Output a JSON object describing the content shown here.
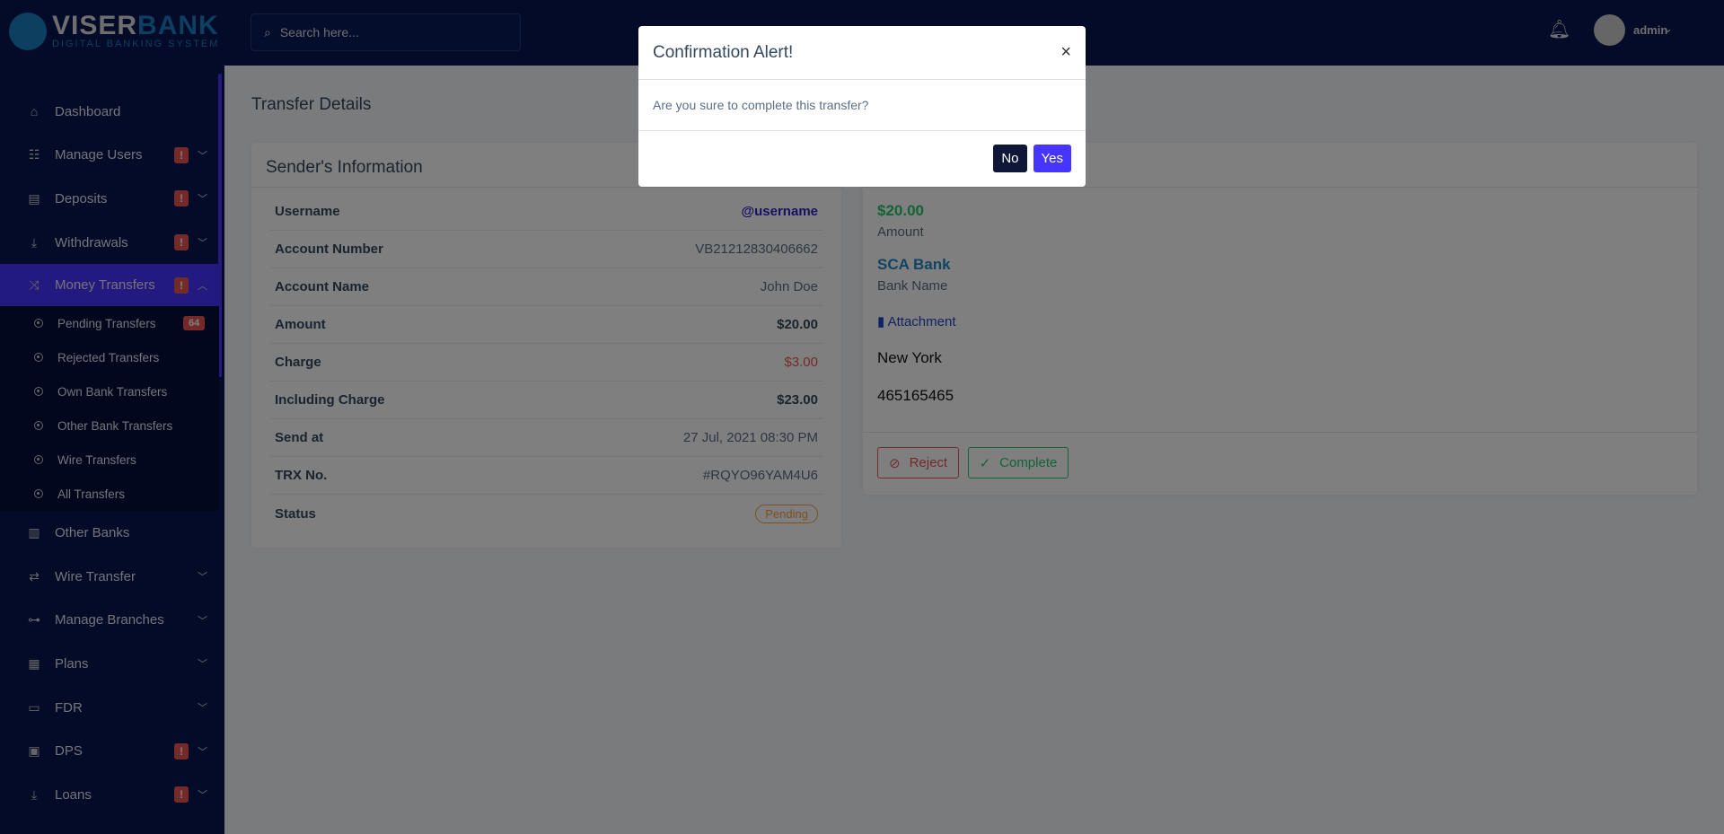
{
  "brand": {
    "name_a": "VISER",
    "name_b": "BANK",
    "tagline": "DIGITAL BANKING SYSTEM"
  },
  "sidebar": {
    "items": [
      {
        "label": "Dashboard",
        "icon": "home-icon",
        "alert": false,
        "chevron": false
      },
      {
        "label": "Manage Users",
        "icon": "users-icon",
        "alert": true,
        "chevron": true
      },
      {
        "label": "Deposits",
        "icon": "deposit-icon",
        "alert": true,
        "chevron": true
      },
      {
        "label": "Withdrawals",
        "icon": "withdraw-icon",
        "alert": true,
        "chevron": true
      },
      {
        "label": "Money Transfers",
        "icon": "shuffle-icon",
        "alert": true,
        "chevron": true,
        "active": true
      }
    ],
    "sub_items": [
      {
        "label": "Pending Transfers",
        "count": "64"
      },
      {
        "label": "Rejected Transfers"
      },
      {
        "label": "Own Bank Transfers"
      },
      {
        "label": "Other Bank Transfers"
      },
      {
        "label": "Wire Transfers"
      },
      {
        "label": "All Transfers"
      }
    ],
    "items_after": [
      {
        "label": "Other Banks",
        "icon": "bank-icon",
        "alert": false,
        "chevron": false
      },
      {
        "label": "Wire Transfer",
        "icon": "wire-icon",
        "alert": false,
        "chevron": true
      },
      {
        "label": "Manage Branches",
        "icon": "branches-icon",
        "alert": false,
        "chevron": true
      },
      {
        "label": "Plans",
        "icon": "chart-icon",
        "alert": false,
        "chevron": true
      },
      {
        "label": "FDR",
        "icon": "money-icon",
        "alert": false,
        "chevron": true
      },
      {
        "label": "DPS",
        "icon": "box-icon",
        "alert": true,
        "chevron": true
      },
      {
        "label": "Loans",
        "icon": "loan-icon",
        "alert": true,
        "chevron": true
      }
    ],
    "alert_mark": "!"
  },
  "topbar": {
    "search_placeholder": "Search here...",
    "user": "admin"
  },
  "page": {
    "title": "Transfer Details"
  },
  "sender": {
    "title": "Sender's Information",
    "rows": [
      {
        "label": "Username",
        "value": "@username"
      },
      {
        "label": "Account Number",
        "value": "VB21212830406662"
      },
      {
        "label": "Account Name",
        "value": "John Doe"
      },
      {
        "label": "Amount",
        "value": "$20.00"
      },
      {
        "label": "Charge",
        "value": "$3.00"
      },
      {
        "label": "Including Charge",
        "value": "$23.00"
      },
      {
        "label": "Send at",
        "value": "27 Jul, 2021 08:30 PM"
      },
      {
        "label": "TRX No.",
        "value": "#RQYO96YAM4U6"
      },
      {
        "label": "Status",
        "value": "Pending"
      }
    ]
  },
  "receiver": {
    "amount": "$20.00",
    "amount_label": "Amount",
    "bank": "SCA Bank",
    "bank_label": "Bank Name",
    "attachment": "Attachment",
    "field1": "New York",
    "field2": "465165465",
    "reject": "Reject",
    "complete": "Complete"
  },
  "modal": {
    "title": "Confirmation Alert!",
    "message": "Are you sure to complete this transfer?",
    "no": "No",
    "yes": "Yes"
  },
  "colors": {
    "sidebar": "#071651",
    "accent": "#4634ff",
    "danger": "#ea5455",
    "success": "#28c76f",
    "warning": "#ff9f43"
  }
}
